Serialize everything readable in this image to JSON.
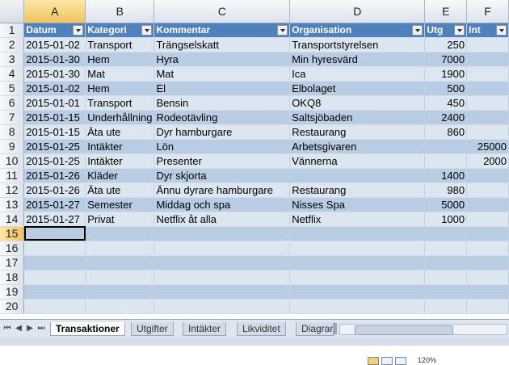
{
  "columns": [
    "A",
    "B",
    "C",
    "D",
    "E",
    "F"
  ],
  "header": {
    "datum": "Datum",
    "kategori": "Kategori",
    "kommentar": "Kommentar",
    "organisation": "Organisation",
    "utg": "Utg",
    "int": "Int"
  },
  "rows": [
    {
      "n": "2",
      "datum": "2015-01-02",
      "kategori": "Transport",
      "kommentar": "Trängselskatt",
      "organisation": "Transportstyrelsen",
      "utg": "250",
      "int": ""
    },
    {
      "n": "3",
      "datum": "2015-01-30",
      "kategori": "Hem",
      "kommentar": "Hyra",
      "organisation": "Min hyresvärd",
      "utg": "7000",
      "int": ""
    },
    {
      "n": "4",
      "datum": "2015-01-30",
      "kategori": "Mat",
      "kommentar": "Mat",
      "organisation": "Ica",
      "utg": "1900",
      "int": ""
    },
    {
      "n": "5",
      "datum": "2015-01-02",
      "kategori": "Hem",
      "kommentar": "El",
      "organisation": "Elbolaget",
      "utg": "500",
      "int": ""
    },
    {
      "n": "6",
      "datum": "2015-01-01",
      "kategori": "Transport",
      "kommentar": "Bensin",
      "organisation": "OKQ8",
      "utg": "450",
      "int": ""
    },
    {
      "n": "7",
      "datum": "2015-01-15",
      "kategori": "Underhållning",
      "kommentar": "Rodeotävling",
      "organisation": "Saltsjöbaden",
      "utg": "2400",
      "int": ""
    },
    {
      "n": "8",
      "datum": "2015-01-15",
      "kategori": "Äta ute",
      "kommentar": "Dyr hamburgare",
      "organisation": "Restaurang",
      "utg": "860",
      "int": ""
    },
    {
      "n": "9",
      "datum": "2015-01-25",
      "kategori": "Intäkter",
      "kommentar": "Lön",
      "organisation": "Arbetsgivaren",
      "utg": "",
      "int": "25000"
    },
    {
      "n": "10",
      "datum": "2015-01-25",
      "kategori": "Intäkter",
      "kommentar": "Presenter",
      "organisation": "Vännerna",
      "utg": "",
      "int": "2000"
    },
    {
      "n": "11",
      "datum": "2015-01-26",
      "kategori": "Kläder",
      "kommentar": "Dyr skjorta",
      "organisation": "",
      "utg": "1400",
      "int": ""
    },
    {
      "n": "12",
      "datum": "2015-01-26",
      "kategori": "Äta ute",
      "kommentar": "Ännu dyrare hamburgare",
      "organisation": "Restaurang",
      "utg": "980",
      "int": ""
    },
    {
      "n": "13",
      "datum": "2015-01-27",
      "kategori": "Semester",
      "kommentar": "Middag och spa",
      "organisation": "Nisses Spa",
      "utg": "5000",
      "int": ""
    },
    {
      "n": "14",
      "datum": "2015-01-27",
      "kategori": "Privat",
      "kommentar": "Netflix åt alla",
      "organisation": "Netflix",
      "utg": "1000",
      "int": ""
    }
  ],
  "empty_rows": [
    "15",
    "16",
    "17",
    "18",
    "19",
    "20"
  ],
  "row_numbers": {
    "header": "1"
  },
  "sheet_tabs": [
    "Transaktioner",
    "Utgifter",
    "Intäkter",
    "Likviditet",
    "Diagram"
  ],
  "nav_icons": [
    "first-sheet-icon",
    "prev-sheet-icon",
    "next-sheet-icon",
    "last-sheet-icon"
  ],
  "status": {
    "zoom": "120%"
  },
  "colors": {
    "header_fill": "#4f81bd",
    "band_light": "#dce6f1",
    "band_dark": "#b8cce4"
  }
}
